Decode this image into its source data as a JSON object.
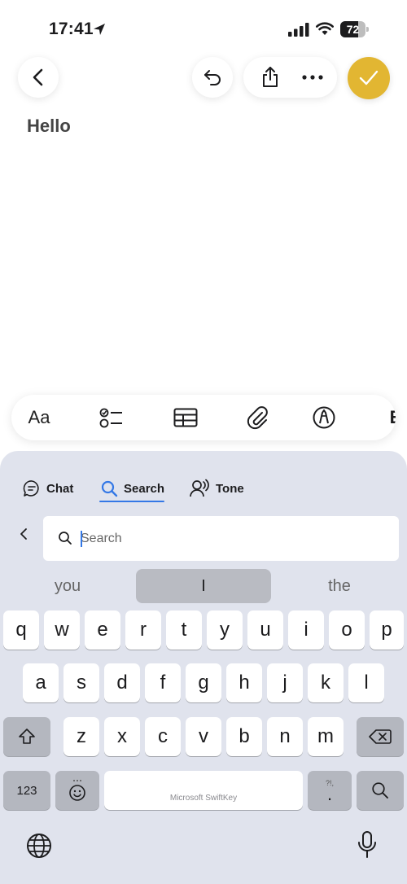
{
  "status": {
    "time": "17:41",
    "battery": "72",
    "battery_level": 0.72
  },
  "toolbar": {
    "back_icon": "chevron-left-icon",
    "undo_icon": "undo-icon",
    "share_icon": "share-icon",
    "more_icon": "more-dots-icon",
    "done_icon": "checkmark-icon",
    "done_color": "#e2b632"
  },
  "note": {
    "title": "Hello"
  },
  "format_bar": {
    "text_style": "Aa",
    "more_partial": "E"
  },
  "keyboard": {
    "tabs": [
      {
        "label": "Chat"
      },
      {
        "label": "Search"
      },
      {
        "label": "Tone"
      }
    ],
    "active_tab": "Search",
    "search_placeholder": "Search",
    "suggestions": [
      "you",
      "I",
      "the"
    ],
    "row1": [
      "q",
      "w",
      "e",
      "r",
      "t",
      "y",
      "u",
      "i",
      "o",
      "p"
    ],
    "row2": [
      "a",
      "s",
      "d",
      "f",
      "g",
      "h",
      "j",
      "k",
      "l"
    ],
    "row3": [
      "z",
      "x",
      "c",
      "v",
      "b",
      "n",
      "m"
    ],
    "numbers_key": "123",
    "space_label": "Microsoft SwiftKey",
    "punct_key": "?!,"
  }
}
